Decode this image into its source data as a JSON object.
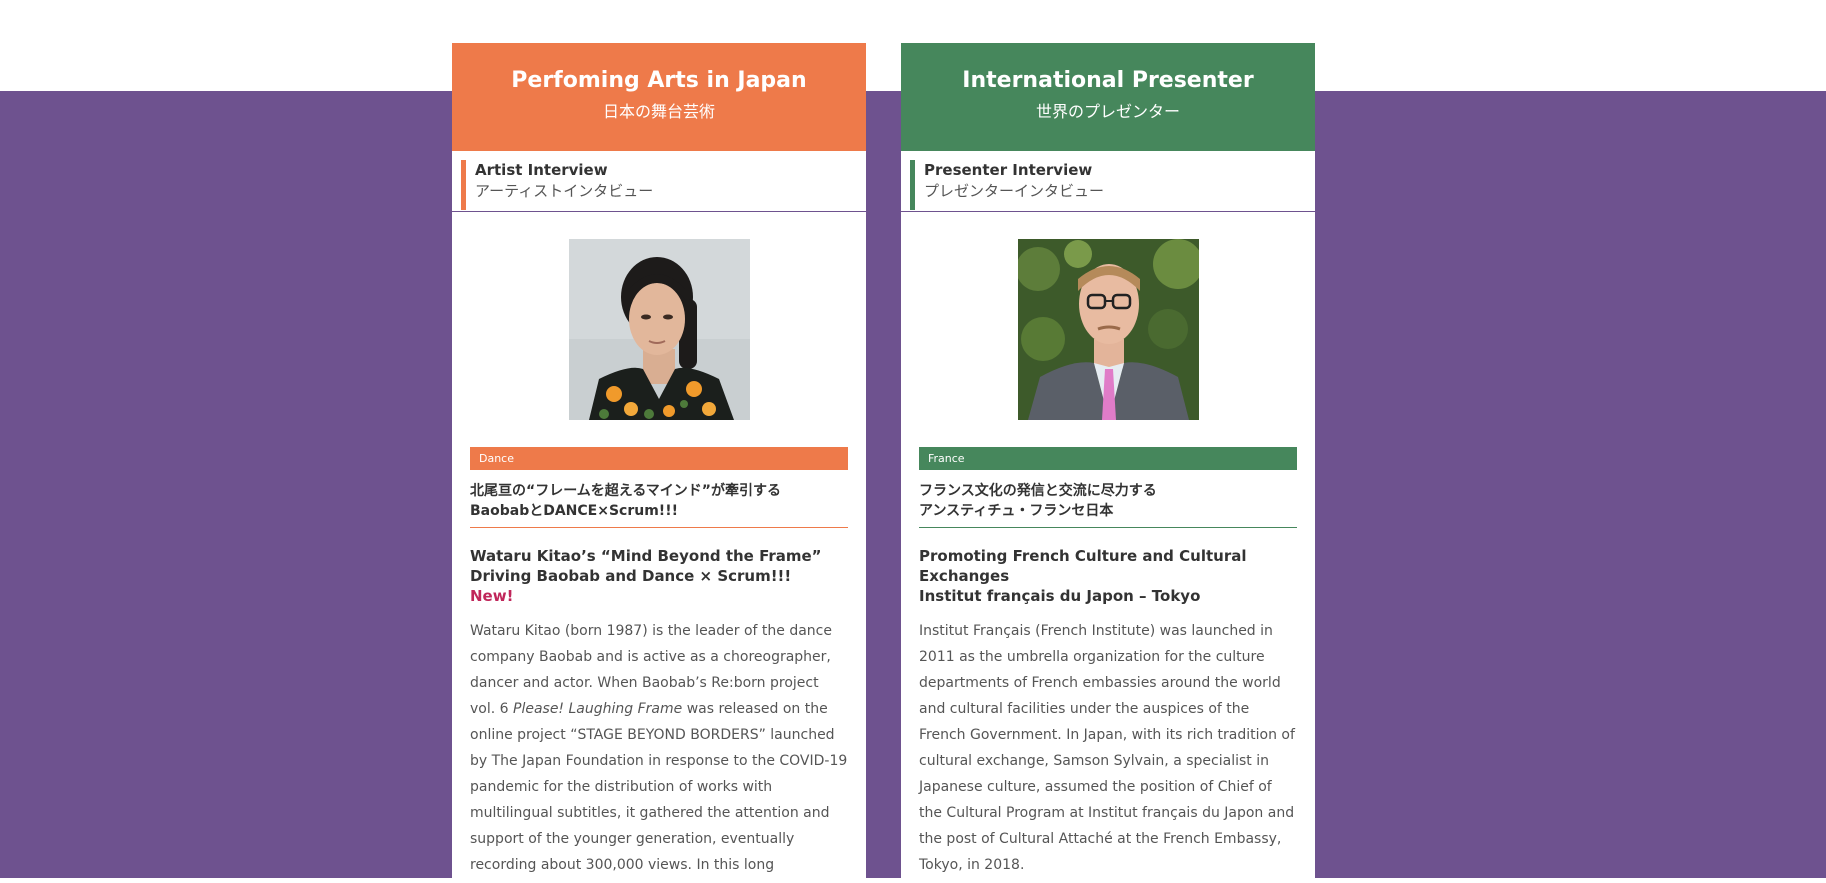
{
  "colors": {
    "purple": "#6e528f",
    "orange": "#ee7a4a",
    "green": "#46875c",
    "new": "#c0265a"
  },
  "cards": [
    {
      "header_title": "Perfoming Arts in Japan",
      "header_sub": "日本の舞台芸術",
      "section_en": "Artist Interview",
      "section_ja": "アーティストインタビュー",
      "photo_icon": "person-photo",
      "tag": "Dance",
      "ja_title_line1": "北尾亘の“フレームを超えるマインド”が牽引する",
      "ja_title_line2": "BaobabとDANCE×Scrum!!!",
      "en_title_line1": "Wataru Kitao’s “Mind Beyond the Frame”",
      "en_title_line2": "Driving Baobab and Dance × Scrum!!!",
      "new_label": "New!",
      "body_part1": "Wataru Kitao (born 1987) is the leader of the dance company Baobab and is active as a choreographer, dancer and actor. When Baobab’s Re:born project vol. 6 ",
      "body_italic": "Please! Laughing Frame",
      "body_part2": " was released on the online project “STAGE BEYOND BORDERS” launched by The Japan Foundation in response to the COVID-19 pandemic for the distribution of works with multilingual subtitles, it gathered the attention and support of the younger generation, eventually recording about 300,000 views. In this long"
    },
    {
      "header_title": "International Presenter",
      "header_sub": "世界のプレゼンター",
      "section_en": "Presenter Interview",
      "section_ja": "プレゼンターインタビュー",
      "photo_icon": "person-photo",
      "tag": "France",
      "ja_title_line1": "フランス文化の発信と交流に尽力する",
      "ja_title_line2": "アンスティチュ・フランセ日本",
      "en_title_line1": "Promoting French Culture and Cultural Exchanges",
      "en_title_line2": "Institut français du Japon – Tokyo",
      "body": "Institut Français (French Institute) was launched in 2011 as the umbrella organization for the culture departments of French embassies around the world and cultural facilities under the auspices of the French Government. In Japan, with its rich tradition of cultural exchange, Samson Sylvain, a specialist in Japanese culture, assumed the position of Chief of the Cultural Program at Institut français du Japon and the post of Cultural Attaché at the French Embassy, Tokyo, in 2018."
    }
  ]
}
